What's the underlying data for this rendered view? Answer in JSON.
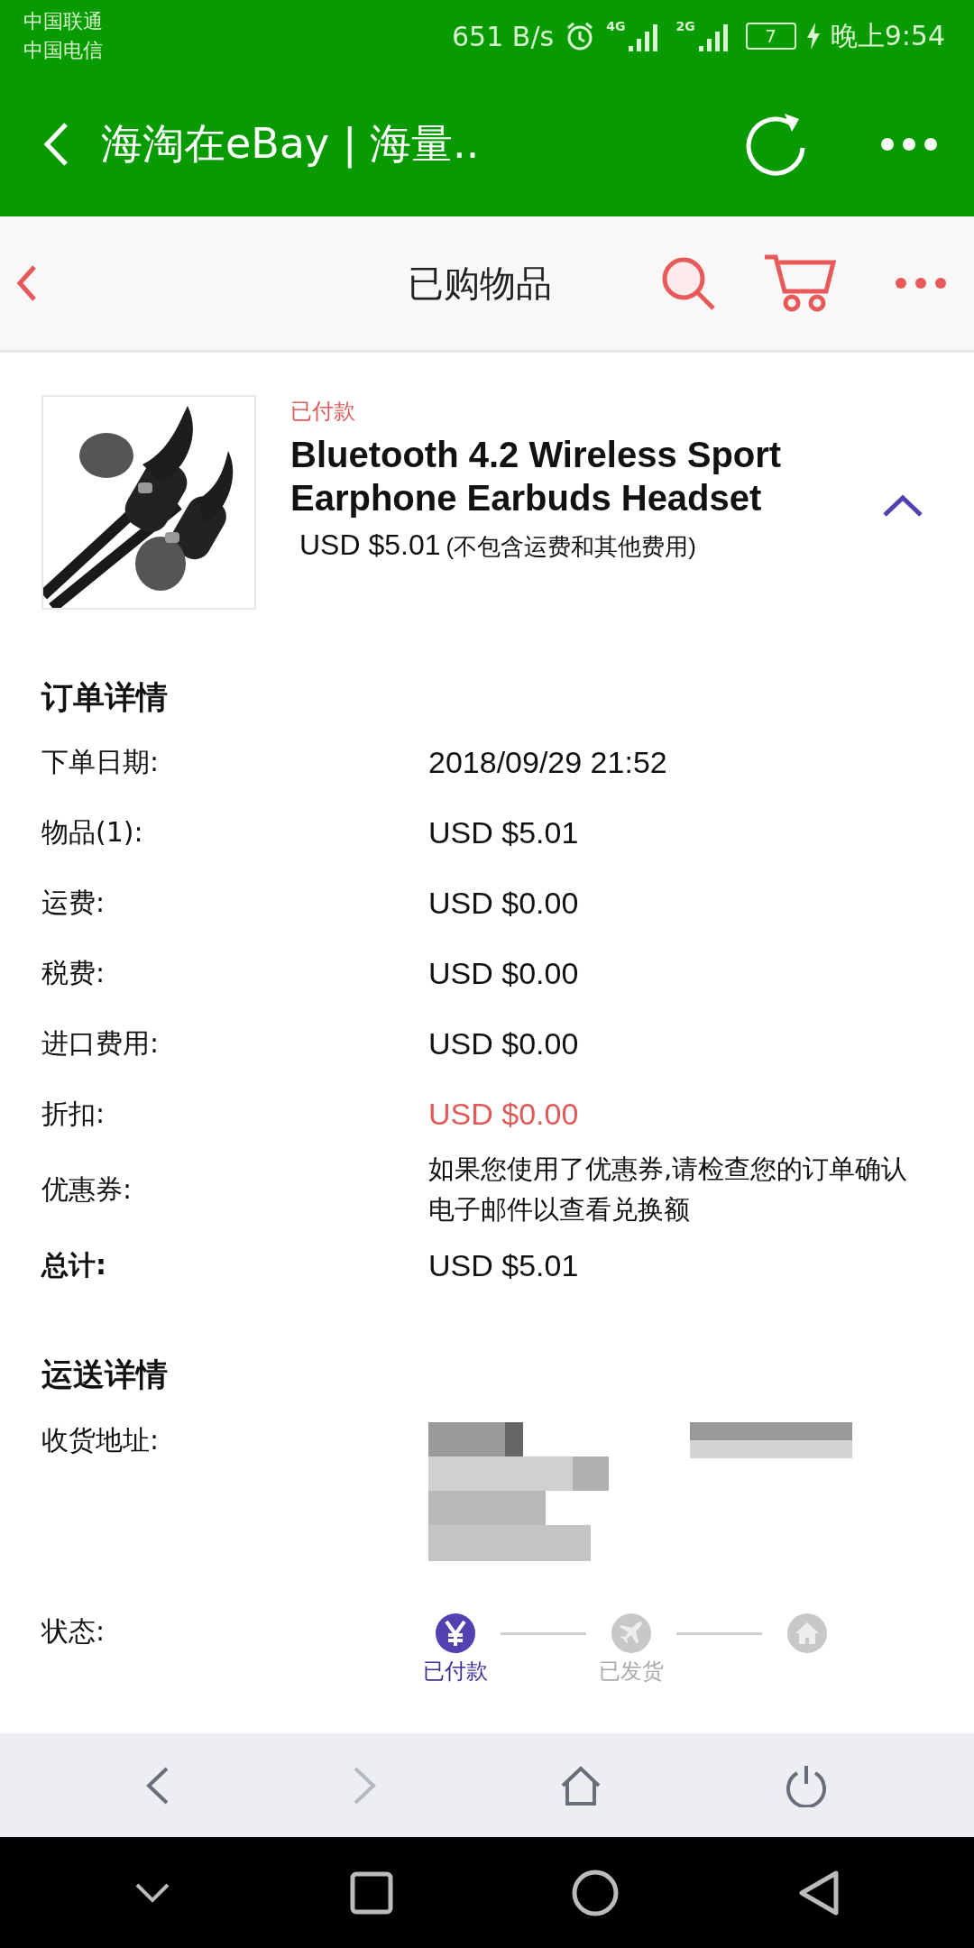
{
  "status_bar": {
    "carriers": [
      "中国联通",
      "中国电信"
    ],
    "network_speed": "651 B/s",
    "signal_1": "4G",
    "signal_2": "2G",
    "battery": "7",
    "time": "晚上9:54"
  },
  "app_bar": {
    "title": "海淘在eBay | 海量.."
  },
  "page_header": {
    "title": "已购物品"
  },
  "item": {
    "status": "已付款",
    "title": "Bluetooth 4.2 Wireless Sport Earphone Earbuds Headset",
    "price": "USD $5.01",
    "price_note": "(不包含运费和其他费用)",
    "expanded": true
  },
  "order_details": {
    "heading": "订单详情",
    "rows": [
      {
        "kind": "plain",
        "label": "下单日期:",
        "value": "2018/09/29 21:52"
      },
      {
        "kind": "plain",
        "label": "物品(1):",
        "value": "USD $5.01"
      },
      {
        "kind": "plain",
        "label": "运费:",
        "value": "USD $0.00"
      },
      {
        "kind": "plain",
        "label": "税费:",
        "value": "USD $0.00"
      },
      {
        "kind": "plain",
        "label": "进口费用:",
        "value": "USD $0.00"
      },
      {
        "kind": "discount",
        "label": "折扣:",
        "value": "USD $0.00"
      },
      {
        "kind": "plain",
        "label": "优惠券:",
        "value": "如果您使用了优惠券,请检查您的订单确认电子邮件以查看兑换额"
      },
      {
        "kind": "total",
        "label": "总计:",
        "value": "USD $5.01"
      }
    ]
  },
  "shipping": {
    "heading": "运送详情",
    "address_label": "收货地址:",
    "status_label": "状态:",
    "steps": [
      {
        "kind": "yen",
        "label": "已付款",
        "done": true
      },
      {
        "kind": "plane",
        "label": "已发货",
        "done": false
      },
      {
        "kind": "home",
        "done": false
      }
    ]
  },
  "browser_bar": {
    "back": {
      "disabled": false
    },
    "forward": {
      "disabled": true
    }
  }
}
